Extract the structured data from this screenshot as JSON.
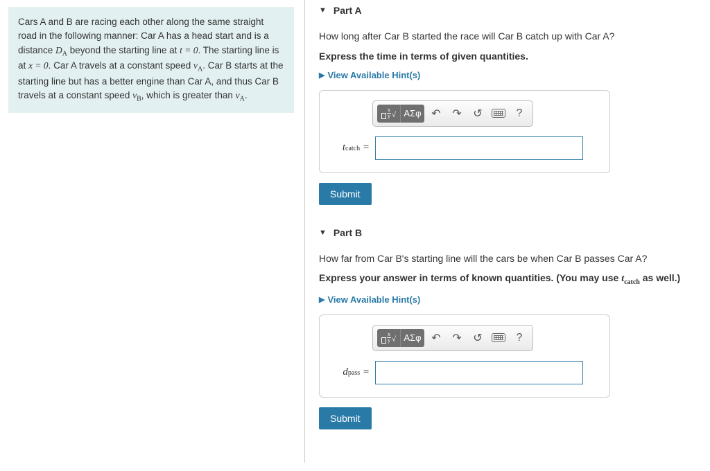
{
  "problem": {
    "text_parts": [
      "Cars A and B are racing each other along the same straight road in the following manner: Car A has a head start and is a distance ",
      " beyond the starting line at ",
      ". The starting line is at ",
      ". Car A travels at a constant speed ",
      ". Car B starts at the starting line but has a better engine than Car A, and thus Car B travels at a constant speed ",
      ", which is greater than ",
      "."
    ],
    "vars": {
      "DA": "D",
      "DA_sub": "A",
      "t0": "t = 0",
      "x0": "x = 0",
      "vA": "v",
      "vA_sub": "A",
      "vB": "v",
      "vB_sub": "B"
    }
  },
  "partA": {
    "title": "Part A",
    "question": "How long after Car B started the race will Car B catch up with Car A?",
    "instruction": "Express the time in terms of given quantities.",
    "hints_label": "View Available Hint(s)",
    "var_label": "t",
    "var_sub": "catch",
    "equals": " =",
    "submit": "Submit",
    "input_value": ""
  },
  "partB": {
    "title": "Part B",
    "question_prefix": "How far from Car B's starting line will the cars be when Car B passes Car A?",
    "instruction_prefix": "Express your answer in terms of known quantities. (You may use ",
    "instruction_suffix": " as well.)",
    "inst_var": "t",
    "inst_var_sub": "catch",
    "hints_label": "View Available Hint(s)",
    "var_label": "d",
    "var_sub": "pass",
    "equals": " =",
    "submit": "Submit",
    "input_value": ""
  },
  "toolbar": {
    "greek": "ΑΣφ",
    "help": "?"
  }
}
